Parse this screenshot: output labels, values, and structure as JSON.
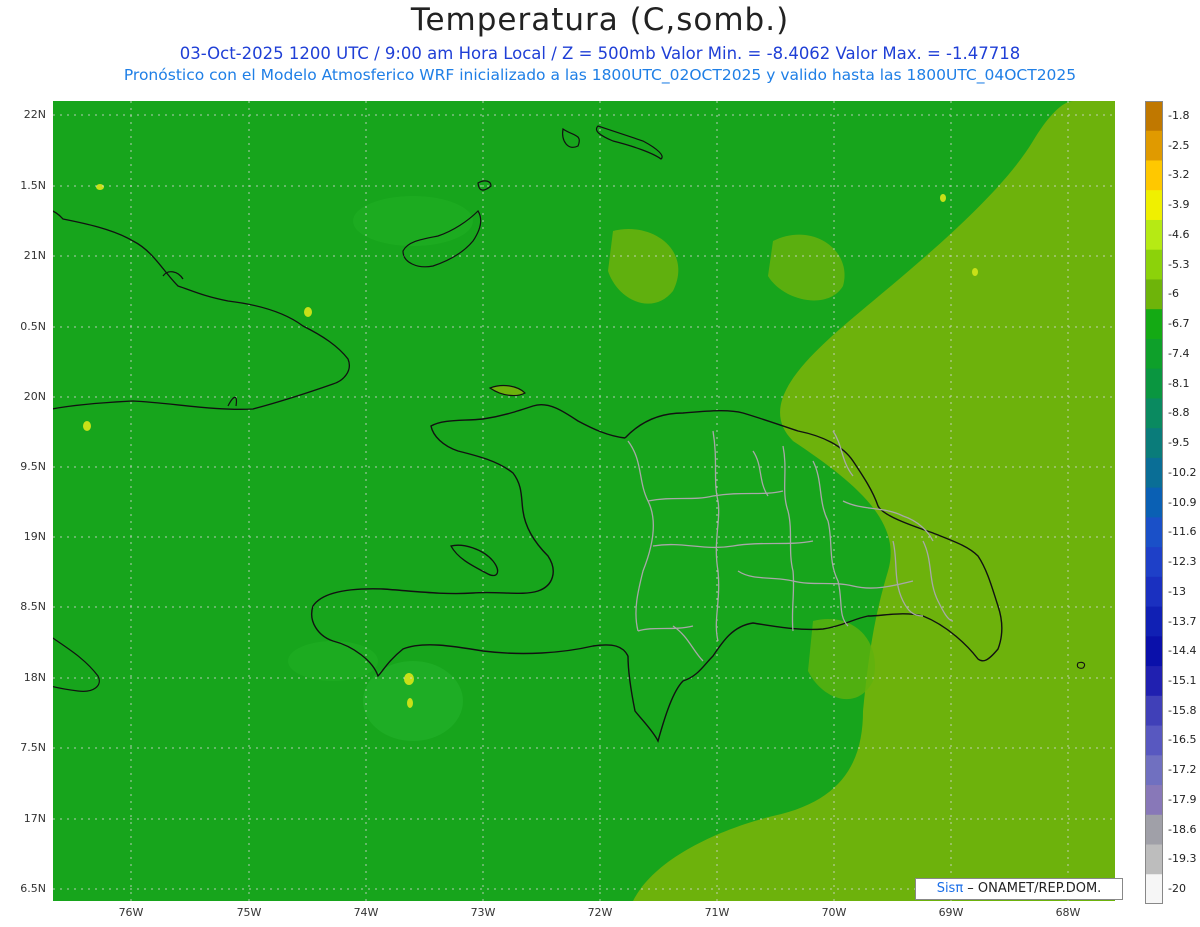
{
  "header": {
    "title": "Temperatura (C,somb.)",
    "line1": "03-Oct-2025  1200 UTC / 9:00 am Hora Local / Z = 500mb   Valor Min. = -8.4062  Valor Max. = -1.47718",
    "line2": "Pronóstico con el Modelo Atmosferico WRF inicializado a las 1800UTC_02OCT2025 y valido hasta las  1800UTC_04OCT2025"
  },
  "axes": {
    "y_labels": [
      "22N",
      "1.5N",
      "21N",
      "0.5N",
      "20N",
      "9.5N",
      "19N",
      "8.5N",
      "18N",
      "7.5N",
      "17N",
      "6.5N"
    ],
    "x_labels": [
      "76W",
      "75W",
      "74W",
      "73W",
      "72W",
      "71W",
      "70W",
      "69W",
      "68W"
    ]
  },
  "colorbar": {
    "labels": [
      "-1.8",
      "-2.5",
      "-3.2",
      "-3.9",
      "-4.6",
      "-5.3",
      "-6",
      "-6.7",
      "-7.4",
      "-8.1",
      "-8.8",
      "-9.5",
      "-10.2",
      "-10.9",
      "-11.6",
      "-12.3",
      "-13",
      "-13.7",
      "-14.4",
      "-15.1",
      "-15.8",
      "-16.5",
      "-17.2",
      "-17.9",
      "-18.6",
      "-19.3",
      "-20"
    ],
    "colors": [
      "#c07800",
      "#e09a00",
      "#ffc800",
      "#f0f000",
      "#b6ea14",
      "#8cd20a",
      "#6eb40a",
      "#14aa14",
      "#0ea02a",
      "#0a9640",
      "#0a8a60",
      "#0a7c7a",
      "#0a6e96",
      "#0a60b4",
      "#1a50c8",
      "#1e40c8",
      "#1a30c0",
      "#1020b4",
      "#0a10aa",
      "#2020b0",
      "#4040b8",
      "#5858c0",
      "#7070c0",
      "#8878b8",
      "#a0a0a8",
      "#bdbdbd",
      "#f6f6f6"
    ]
  },
  "credit": {
    "brand": "Sisπ",
    "text": " – ONAMET/REP.DOM."
  },
  "map_colors": {
    "ocean": "#17a51c",
    "warm_area": "#6db20c",
    "yellow_spot": "#c8e018"
  }
}
